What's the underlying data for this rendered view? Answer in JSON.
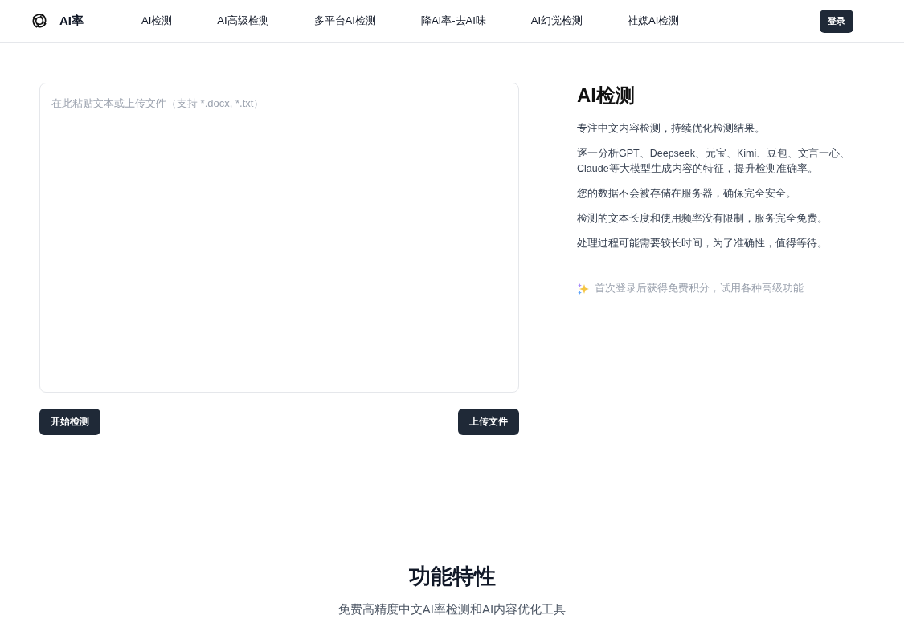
{
  "header": {
    "brand": "AI率",
    "nav": [
      {
        "label": "AI检测"
      },
      {
        "label": "AI高级检测"
      },
      {
        "label": "多平台AI检测"
      },
      {
        "label": "降AI率-去AI味"
      },
      {
        "label": "AI幻觉检测"
      },
      {
        "label": "社媒AI检测"
      }
    ],
    "login_button": "登录"
  },
  "editor": {
    "placeholder": "在此粘贴文本或上传文件（支持 *.docx, *.txt）",
    "start_button": "开始检测",
    "upload_button": "上传文件"
  },
  "info": {
    "title": "AI检测",
    "paragraphs": [
      "专注中文内容检测，持续优化检测结果。",
      "逐一分析GPT、Deepseek、元宝、Kimi、豆包、文言一心、Claude等大模型生成内容的特征，提升检测准确率。",
      "您的数据不会被存储在服务器，确保完全安全。",
      "检测的文本长度和使用频率没有限制，服务完全免费。",
      "处理过程可能需要较长时间，为了准确性，值得等待。"
    ],
    "tip": "首次登录后获得免费积分，试用各种高级功能"
  },
  "features": {
    "title": "功能特性",
    "subtitle": "免费高精度中文AI率检测和AI内容优化工具"
  }
}
